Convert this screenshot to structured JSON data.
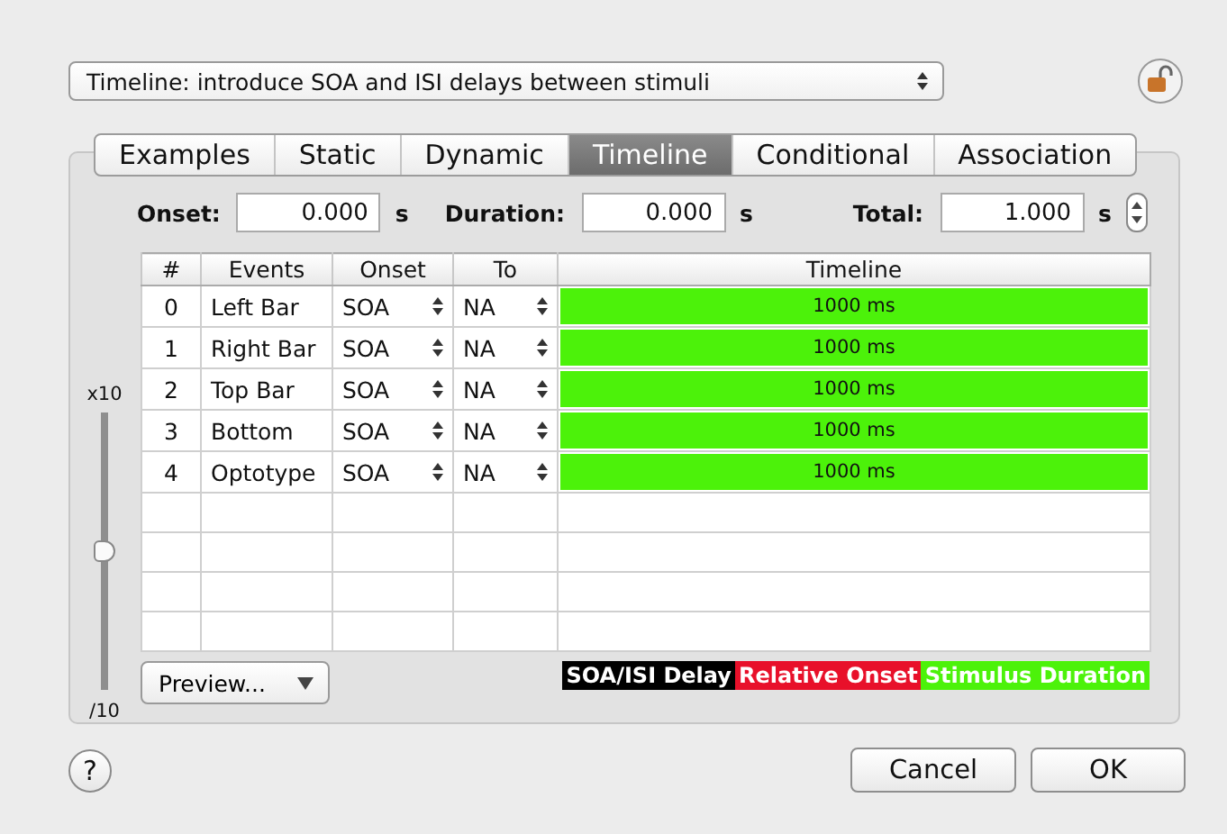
{
  "preset": {
    "value": "Timeline: introduce SOA and ISI delays between stimuli"
  },
  "tabs": [
    {
      "label": "Examples",
      "selected": false
    },
    {
      "label": "Static",
      "selected": false
    },
    {
      "label": "Dynamic",
      "selected": false
    },
    {
      "label": "Timeline",
      "selected": true
    },
    {
      "label": "Conditional",
      "selected": false
    },
    {
      "label": "Association",
      "selected": false
    }
  ],
  "fields": [
    {
      "label": "Onset:",
      "value": "0.000",
      "unit": "s"
    },
    {
      "label": "Duration:",
      "value": "0.000",
      "unit": "s"
    },
    {
      "label": "Total:",
      "value": "1.000",
      "unit": "s"
    }
  ],
  "zoom_slider": {
    "top_label": "x10",
    "bottom_label": "/10",
    "level": 0.5
  },
  "table": {
    "columns": [
      "#",
      "Events",
      "Onset",
      "To",
      "Timeline"
    ],
    "rows": [
      {
        "index": "0",
        "event": "Left Bar",
        "onset": "SOA",
        "to": "NA",
        "timeline": "1000 ms"
      },
      {
        "index": "1",
        "event": "Right Bar",
        "onset": "SOA",
        "to": "NA",
        "timeline": "1000 ms"
      },
      {
        "index": "2",
        "event": "Top Bar",
        "onset": "SOA",
        "to": "NA",
        "timeline": "1000 ms"
      },
      {
        "index": "3",
        "event": "Bottom",
        "onset": "SOA",
        "to": "NA",
        "timeline": "1000 ms"
      },
      {
        "index": "4",
        "event": "Optotype",
        "onset": "SOA",
        "to": "NA",
        "timeline": "1000 ms"
      }
    ]
  },
  "preview_button": "Preview...",
  "legend": [
    {
      "label": "SOA/ISI Delay",
      "color": "#000000"
    },
    {
      "label": "Relative Onset",
      "color": "#e8102a"
    },
    {
      "label": "Stimulus Duration",
      "color": "#4cf20a"
    }
  ],
  "buttons": [
    {
      "label": "?",
      "kind": "help"
    },
    {
      "label": "Cancel",
      "kind": "push"
    },
    {
      "label": "OK",
      "kind": "push"
    }
  ]
}
